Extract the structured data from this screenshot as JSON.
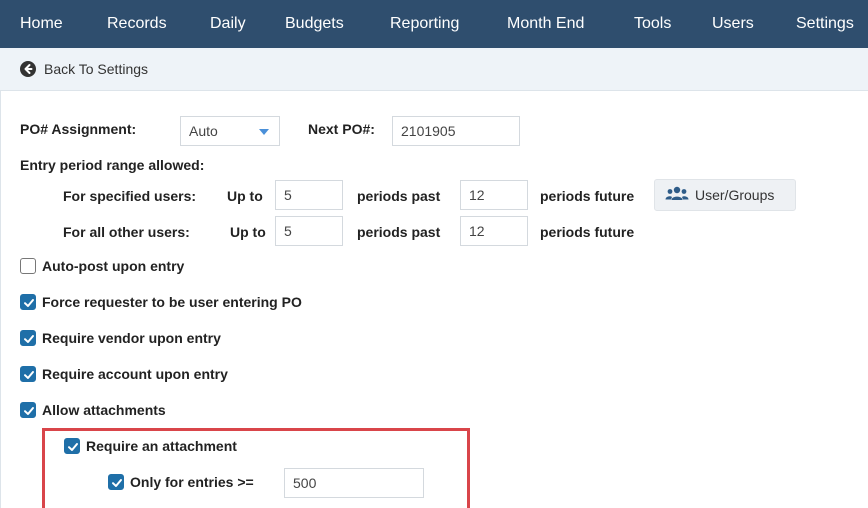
{
  "nav": {
    "items": [
      "Home",
      "Records",
      "Daily",
      "Budgets",
      "Reporting",
      "Month End",
      "Tools",
      "Users",
      "Settings"
    ]
  },
  "back": {
    "label": "Back To Settings"
  },
  "po": {
    "assignment_label": "PO# Assignment:",
    "assignment_value": "Auto",
    "next_label": "Next PO#:",
    "next_value": "2101905"
  },
  "entry_period": {
    "heading": "Entry period range allowed:",
    "specified": {
      "label": "For specified users:",
      "up_to": "Up to",
      "past_value": "5",
      "past_label": "periods past",
      "future_value": "12",
      "future_label": "periods future"
    },
    "other": {
      "label": "For all other users:",
      "up_to": "Up to",
      "past_value": "5",
      "past_label": "periods past",
      "future_value": "12",
      "future_label": "periods future"
    },
    "user_groups_button": "User/Groups"
  },
  "options": [
    {
      "label": "Auto-post upon entry",
      "checked": false
    },
    {
      "label": "Force requester to be user entering PO",
      "checked": true
    },
    {
      "label": "Require vendor upon entry",
      "checked": true
    },
    {
      "label": "Require account upon entry",
      "checked": true
    },
    {
      "label": "Allow attachments",
      "checked": true
    }
  ],
  "attachment": {
    "require_label": "Require an attachment",
    "require_checked": true,
    "only_label": "Only for entries >=",
    "only_checked": true,
    "threshold_value": "500"
  },
  "colors": {
    "nav_bg": "#2f4e6e",
    "checkbox": "#1f6fa8",
    "highlight_border": "#d9454a"
  }
}
